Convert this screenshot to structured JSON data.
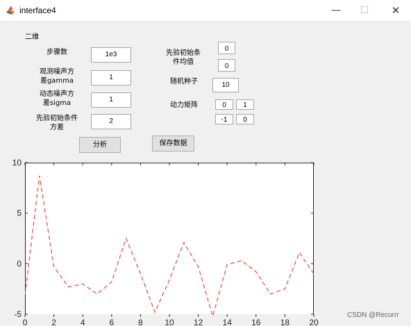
{
  "window": {
    "title": "interface4",
    "minimize": "—",
    "maximize": "☐",
    "close": "✕"
  },
  "panel": {
    "title": "二维"
  },
  "left_fields": [
    {
      "label_lines": [
        "步骤数"
      ],
      "value": "1e3"
    },
    {
      "label_lines": [
        "观测噪声方",
        "差gamma"
      ],
      "value": "1"
    },
    {
      "label_lines": [
        "动态噪声方",
        "差sigma"
      ],
      "value": "1"
    },
    {
      "label_lines": [
        "先验初始条件",
        "方差"
      ],
      "value": "2"
    }
  ],
  "prior_mean": {
    "label_lines": [
      "先验初始条",
      "件均值"
    ],
    "values": [
      "0",
      "0"
    ]
  },
  "random_seed": {
    "label": "随机种子",
    "value": "10"
  },
  "dynamics_matrix": {
    "label": "动力矩阵",
    "values": [
      [
        "0",
        "1"
      ],
      [
        "-1",
        "0"
      ]
    ]
  },
  "buttons": {
    "analyze": "分析",
    "save": "保存数据"
  },
  "watermark": "CSDN @Recurrr",
  "chart_data": {
    "type": "line",
    "line_style": "dashed",
    "color": "#e8524a",
    "x": [
      0,
      1,
      2,
      3,
      4,
      5,
      6,
      7,
      8,
      9,
      10,
      11,
      12,
      13,
      14,
      15,
      16,
      17,
      18,
      19,
      20
    ],
    "y": [
      -3.1,
      8.7,
      -0.3,
      -2.3,
      -2.0,
      -3.0,
      -1.8,
      2.5,
      -1.0,
      -4.8,
      -1.6,
      2.1,
      -0.3,
      -5.2,
      -0.1,
      0.3,
      -0.8,
      -3.0,
      -2.5,
      1.1,
      -1.0
    ],
    "xlim": [
      0,
      20
    ],
    "ylim": [
      -5,
      10
    ],
    "xticks": [
      0,
      2,
      4,
      6,
      8,
      10,
      12,
      14,
      16,
      18,
      20
    ],
    "yticks": [
      -5,
      0,
      5,
      10
    ],
    "grid": false,
    "title": "",
    "xlabel": "",
    "ylabel": ""
  }
}
